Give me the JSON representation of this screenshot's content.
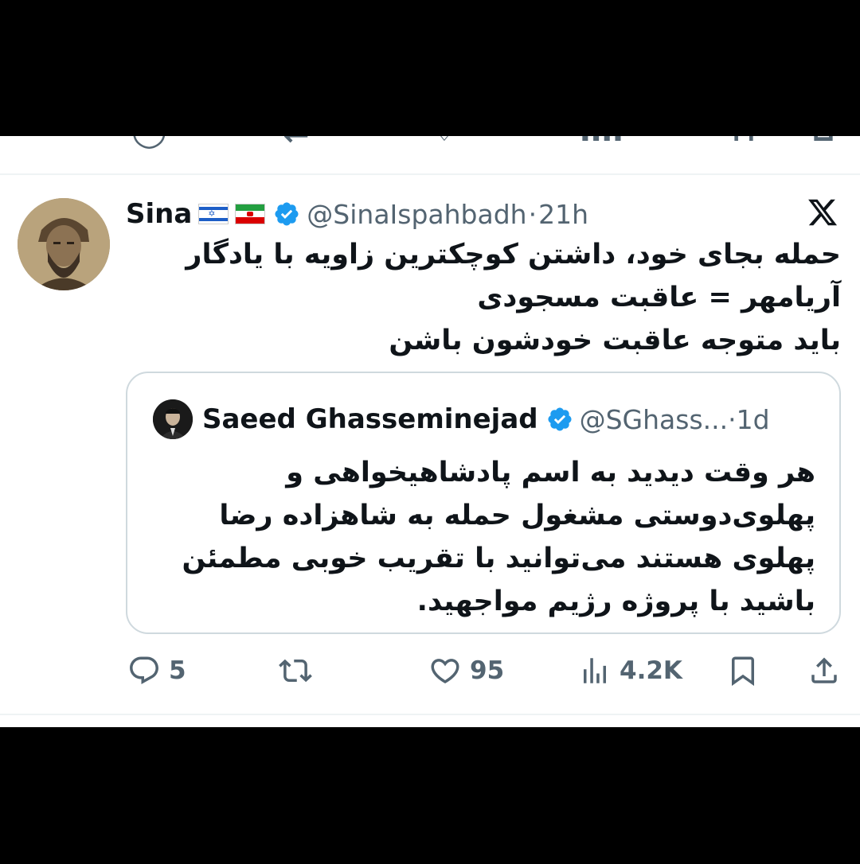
{
  "tweet": {
    "display_name": "Sina",
    "flags": [
      "israel-flag",
      "iran-lion-sun-flag"
    ],
    "handle": "@SinaIspahbadh",
    "separator": "·",
    "time": "21h",
    "text_lines": [
      "حمله بجای خود، داشتن کوچکترین زاویه با یادگار",
      "آریامهر = عاقبت مسجودی",
      "باید متوجه عاقبت خودشون باشن"
    ]
  },
  "quoted_tweet": {
    "display_name": "Saeed Ghasseminejad",
    "handle": "@SGhass...",
    "separator": "·",
    "time": "1d",
    "text_lines": [
      "هر وقت دیدید به اسم پادشاهیخواهی و",
      "پهلوی‌دوستی مشغول حمله به شاهزاده رضا",
      "پهلوی هستند می‌توانید با تقریب خوبی مطمئن",
      "باشید با پروژه رژیم مواجهید."
    ]
  },
  "actions": {
    "replies": "5",
    "retweets": "",
    "likes": "95",
    "views": "4.2K"
  },
  "colors": {
    "text_primary": "#0f1419",
    "text_secondary": "#536471",
    "verified_blue": "#1d9bf0",
    "border": "#cfd9de"
  },
  "icons": [
    "reply-icon",
    "retweet-icon",
    "like-icon",
    "views-icon",
    "bookmark-icon",
    "share-icon",
    "x-logo-icon",
    "verified-badge-icon"
  ]
}
